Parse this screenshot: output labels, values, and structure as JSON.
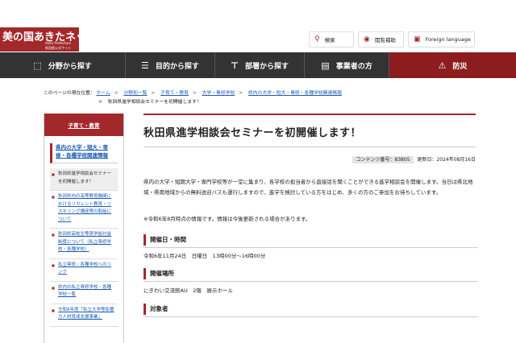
{
  "header": {
    "logo_main": "美の国あきたネット",
    "logo_sub1": "Akita Prefecture",
    "logo_sub2": "秋田県公式サイト",
    "search_label": "検索",
    "accessibility_label": "閲覧補助",
    "language_label": "Foreign language"
  },
  "nav": {
    "items": [
      {
        "label": "分野から探す",
        "icon": "map-icon"
      },
      {
        "label": "目的から探す",
        "icon": "list-icon"
      },
      {
        "label": "部署から探す",
        "icon": "org-icon"
      },
      {
        "label": "事業者の方",
        "icon": "briefcase-icon"
      },
      {
        "label": "防災",
        "icon": "warning-icon"
      }
    ]
  },
  "breadcrumb": {
    "prefix": "このページの現在位置：",
    "items": [
      "ホーム",
      "分野別一覧",
      "子育て・教育",
      "大学・専修学校",
      "県内の大学・短大・専修・各種学校関連情報"
    ],
    "current": "秋田県進学相談会セミナーを初開催します！"
  },
  "sidebar": {
    "title": "子育て・教育",
    "subtitle": "県内の大学・短大・専修・各種学校関連情報",
    "items": [
      {
        "label": "秋田県進学相談会セミナーを初開催します！",
        "current": true
      },
      {
        "label": "秋田県内の高等教育機関におけるリカレント教育・リスキリング講座等の取組について",
        "current": false
      },
      {
        "label": "秋田県高校生等奨学給付金制度について（私立専修学校・各種学校）",
        "current": false
      },
      {
        "label": "私立専修・各種学校へのリンク",
        "current": false
      },
      {
        "label": "県内の私立専修学校・各種学校一覧",
        "current": false
      },
      {
        "label": "令和6年度「私立大学等影響力人材育成支援事業」",
        "current": false
      }
    ]
  },
  "article": {
    "title": "秋田県進学相談会セミナーを初開催します！",
    "content_no_label": "コンテンツ番号：",
    "content_no": "83805",
    "updated_label": "更新日：",
    "updated": "2024年08月16日",
    "para1": "県内の大学・短期大学・専門学校等が一堂に集まり、各学校の担当者から直接話を聞くことができる進学相談会を開催します。当日は県北地域・県南地域からの無料送迎バスも運行しますので、進学を検討している方をはじめ、多くの方のご参加をお待ちしています。",
    "note": "※令和6年8月時点の情報です。情報は今後更新される場合があります。",
    "h_datetime": "開催日・時間",
    "datetime": "令和6年11月24日　日曜日　13時00分～16時00分",
    "h_venue": "開催場所",
    "venue": "にぎわい交流館AU　2階　展示ホール",
    "h_target": "対象者"
  }
}
